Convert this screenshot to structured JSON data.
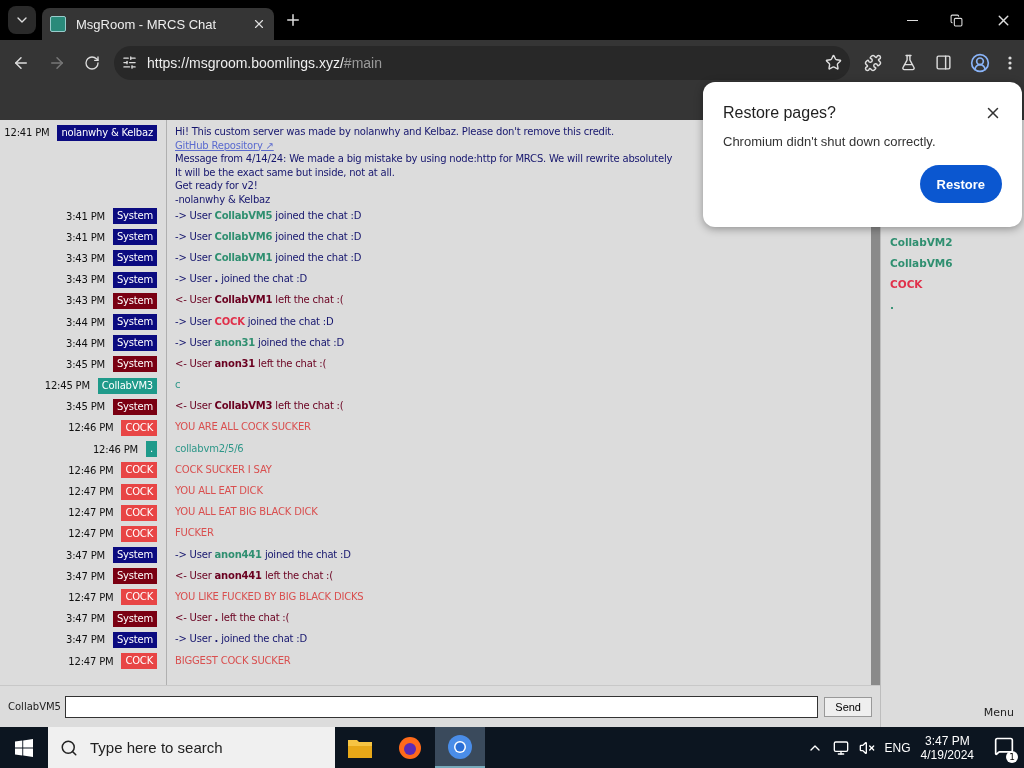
{
  "browser": {
    "tab_title": "MsgRoom - MRCS Chat",
    "url_host": "https://msgroom.boomlings.xyz/",
    "url_path": "#main"
  },
  "messages": [
    {
      "time": "12:41 PM",
      "user": "nolanwhy & Kelbaz",
      "color": "#0b0b80",
      "kind": "multi",
      "lines": [
        {
          "kind": "text",
          "text": "Hi! This custom server was made by nolanwhy and Kelbaz. Please don't remove this credit."
        },
        {
          "kind": "link",
          "text": "GitHub Repository ↗"
        },
        {
          "kind": "text",
          "text": "Message from 4/14/24: We made a big mistake by using node:http for MRCS. We will rewrite absolutely"
        },
        {
          "kind": "text",
          "text": "It will be the exact same but inside, not at all."
        },
        {
          "kind": "text",
          "text": "Get ready for v2!"
        },
        {
          "kind": "text",
          "text": "-nolanwhy & Kelbaz"
        }
      ]
    },
    {
      "time": "3:41 PM",
      "user": "System",
      "color": "#0b0b80",
      "kind": "join",
      "prefix": "-> User",
      "name": {
        "text": "CollabVM5",
        "color": "#2f8f70"
      },
      "suffix": "joined the chat :D"
    },
    {
      "time": "3:41 PM",
      "user": "System",
      "color": "#0b0b80",
      "kind": "join",
      "prefix": "-> User",
      "name": {
        "text": "CollabVM6",
        "color": "#2f8f70"
      },
      "suffix": "joined the chat :D"
    },
    {
      "time": "3:43 PM",
      "user": "System",
      "color": "#0b0b80",
      "kind": "join",
      "prefix": "-> User",
      "name": {
        "text": "CollabVM1",
        "color": "#2f8f70"
      },
      "suffix": "joined the chat :D"
    },
    {
      "time": "3:43 PM",
      "user": "System",
      "color": "#0b0b80",
      "kind": "join",
      "prefix": "-> User",
      "name": {
        "text": "."
      },
      "suffix": "joined the chat :D"
    },
    {
      "time": "3:43 PM",
      "user": "System",
      "color": "#7a0012",
      "kind": "leave",
      "prefix": "<- User",
      "name": {
        "text": "CollabVM1"
      },
      "suffix": "left the chat :("
    },
    {
      "time": "3:44 PM",
      "user": "System",
      "color": "#0b0b80",
      "kind": "join",
      "prefix": "-> User",
      "name": {
        "text": "COCK",
        "color": "#e0304a"
      },
      "suffix": "joined the chat :D"
    },
    {
      "time": "3:44 PM",
      "user": "System",
      "color": "#0b0b80",
      "kind": "join",
      "prefix": "-> User",
      "name": {
        "text": "anon31",
        "color": "#2f8f70"
      },
      "suffix": "joined the chat :D"
    },
    {
      "time": "3:45 PM",
      "user": "System",
      "color": "#7a0012",
      "kind": "leave",
      "prefix": "<- User",
      "name": {
        "text": "anon31"
      },
      "suffix": "left the chat :("
    },
    {
      "time": "12:45 PM",
      "user": "CollabVM3",
      "color": "#1f9a8a",
      "kind": "text",
      "text": "c"
    },
    {
      "time": "3:45 PM",
      "user": "System",
      "color": "#7a0012",
      "kind": "leave",
      "prefix": "<- User",
      "name": {
        "text": "CollabVM3"
      },
      "suffix": "left the chat :("
    },
    {
      "time": "12:46 PM",
      "user": "COCK",
      "color": "#e84545",
      "kind": "text",
      "text": "YOU ARE ALL COCK SUCKER"
    },
    {
      "time": "12:46 PM",
      "user": ".",
      "color": "#1f9a8a",
      "kind": "text",
      "text": "collabvm2/5/6"
    },
    {
      "time": "12:46 PM",
      "user": "COCK",
      "color": "#e84545",
      "kind": "text",
      "text": "COCK SUCKER I SAY"
    },
    {
      "time": "12:47 PM",
      "user": "COCK",
      "color": "#e84545",
      "kind": "text",
      "text": "YOU ALL EAT DICK"
    },
    {
      "time": "12:47 PM",
      "user": "COCK",
      "color": "#e84545",
      "kind": "text",
      "text": "YOU ALL EAT BIG BLACK DICK"
    },
    {
      "time": "12:47 PM",
      "user": "COCK",
      "color": "#e84545",
      "kind": "text",
      "text": "FUCKER"
    },
    {
      "time": "3:47 PM",
      "user": "System",
      "color": "#0b0b80",
      "kind": "join",
      "prefix": "-> User",
      "name": {
        "text": "anon441",
        "color": "#2f8f70"
      },
      "suffix": "joined the chat :D"
    },
    {
      "time": "3:47 PM",
      "user": "System",
      "color": "#7a0012",
      "kind": "leave",
      "prefix": "<- User",
      "name": {
        "text": "anon441"
      },
      "suffix": "left the chat :("
    },
    {
      "time": "12:47 PM",
      "user": "COCK",
      "color": "#e84545",
      "kind": "text",
      "text": "YOU LIKE FUCKED BY BIG BLACK DICKS"
    },
    {
      "time": "3:47 PM",
      "user": "System",
      "color": "#7a0012",
      "kind": "leave",
      "prefix": "<- User",
      "name": {
        "text": "."
      },
      "suffix": "left the chat :("
    },
    {
      "time": "3:47 PM",
      "user": "System",
      "color": "#0b0b80",
      "kind": "join",
      "prefix": "-> User",
      "name": {
        "text": "."
      },
      "suffix": "joined the chat :D"
    },
    {
      "time": "12:47 PM",
      "user": "COCK",
      "color": "#e84545",
      "kind": "text",
      "text": "BIGGEST COCK SUCKER"
    }
  ],
  "users": [
    {
      "name": "CollabVM2",
      "color": "#2f8f70"
    },
    {
      "name": "CollabVM6",
      "color": "#2f8f70"
    },
    {
      "name": "COCK",
      "color": "#e0304a"
    },
    {
      "name": ".",
      "color": "#2f8f70"
    }
  ],
  "composer": {
    "nickname": "CollabVM5",
    "send": "Send"
  },
  "menu": "Menu",
  "restore_popup": {
    "title": "Restore pages?",
    "message": "Chromium didn't shut down correctly.",
    "button": "Restore"
  },
  "taskbar": {
    "search_placeholder": "Type here to search",
    "language": "ENG",
    "time": "3:47 PM",
    "date": "4/19/2024",
    "notifications": "1"
  }
}
